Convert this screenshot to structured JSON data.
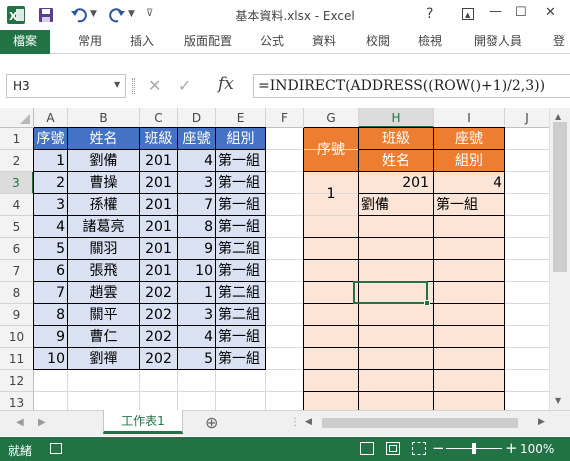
{
  "window": {
    "title": "基本資料.xlsx - Excel",
    "help": "?",
    "minimize": "—",
    "maximize": "☐",
    "close": "✕"
  },
  "qat": {
    "save": "save-icon",
    "undo": "undo-icon",
    "redo": "redo-icon"
  },
  "ribbon": {
    "tabs": [
      "檔案",
      "常用",
      "插入",
      "版面配置",
      "公式",
      "資料",
      "校閱",
      "檢視",
      "開發人員",
      "登"
    ]
  },
  "formula_bar": {
    "name_box": "H3",
    "cancel": "✕",
    "enter": "✓",
    "fx": "fx",
    "formula": "=INDIRECT(ADDRESS((ROW()+1)/2,3))"
  },
  "columns": [
    "A",
    "B",
    "C",
    "D",
    "E",
    "F",
    "G",
    "H",
    "I",
    "J"
  ],
  "rows": [
    "1",
    "2",
    "3",
    "4",
    "5",
    "6",
    "7",
    "8",
    "9",
    "10",
    "11",
    "12",
    "13"
  ],
  "left_table": {
    "headers": [
      "序號",
      "姓名",
      "班級",
      "座號",
      "組別"
    ],
    "rows": [
      [
        "1",
        "劉備",
        "201",
        "4",
        "第一組"
      ],
      [
        "2",
        "曹操",
        "201",
        "3",
        "第一組"
      ],
      [
        "3",
        "孫權",
        "201",
        "7",
        "第一組"
      ],
      [
        "4",
        "諸葛亮",
        "201",
        "8",
        "第一組"
      ],
      [
        "5",
        "關羽",
        "201",
        "9",
        "第二組"
      ],
      [
        "6",
        "張飛",
        "201",
        "10",
        "第一組"
      ],
      [
        "7",
        "趙雲",
        "202",
        "1",
        "第二組"
      ],
      [
        "8",
        "關平",
        "202",
        "3",
        "第二組"
      ],
      [
        "9",
        "曹仁",
        "202",
        "4",
        "第一組"
      ],
      [
        "10",
        "劉禪",
        "202",
        "5",
        "第一組"
      ]
    ]
  },
  "right_table": {
    "header_g": "序號",
    "header_h1": "班級",
    "header_h2": "姓名",
    "header_i1": "座號",
    "header_i2": "組別",
    "g3": "1",
    "h3": "201",
    "i3": "4",
    "h4": "劉備",
    "i4": "第一組"
  },
  "sheet_tabs": {
    "active": "工作表1",
    "add": "⊕"
  },
  "status": {
    "mode": "就緒",
    "zoom": "100%",
    "zoom_minus": "−",
    "zoom_plus": "+"
  },
  "colors": {
    "excel_green": "#217346",
    "header_blue": "#4472c4",
    "data_blue": "#d9e1f2",
    "header_orange": "#ed7d31",
    "data_peach": "#fce4d6"
  }
}
